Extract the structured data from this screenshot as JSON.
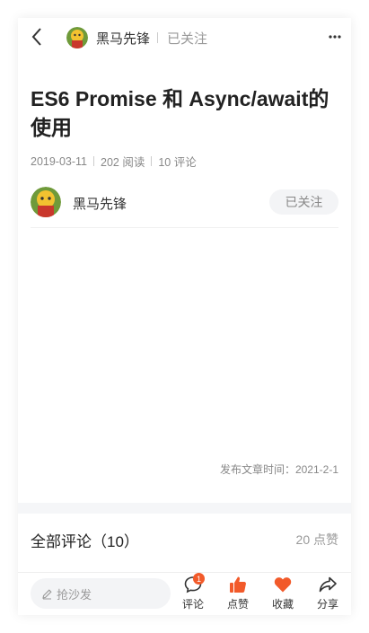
{
  "nav": {
    "author": "黑马先锋",
    "follow_status": "已关注"
  },
  "article": {
    "title": "ES6 Promise 和 Async/await的使用",
    "date": "2019-03-11",
    "reads": "202 阅读",
    "comments": "10 评论",
    "author": "黑马先锋",
    "follow_button": "已关注",
    "publish_time": "发布文章时间：2021-2-1"
  },
  "comments": {
    "header": "全部评论（10）",
    "likes": "20 点赞"
  },
  "bottom": {
    "input_placeholder": "抢沙发",
    "comment_label": "评论",
    "comment_badge": "1",
    "like_label": "点赞",
    "collect_label": "收藏",
    "share_label": "分享"
  },
  "colors": {
    "accent": "#f25a2a",
    "muted": "#999999"
  }
}
